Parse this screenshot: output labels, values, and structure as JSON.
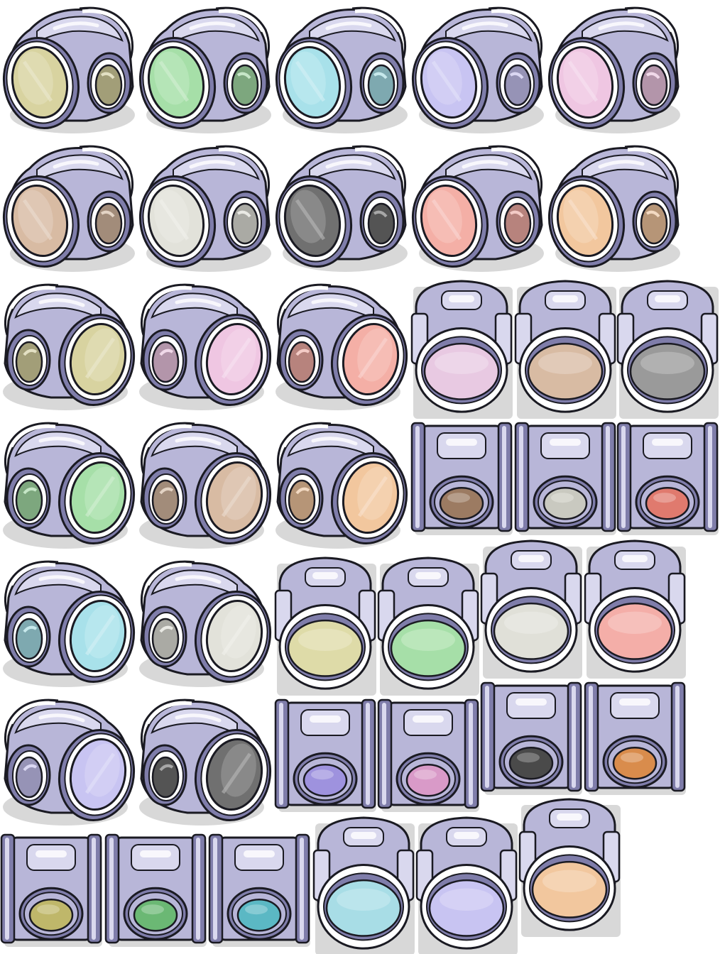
{
  "sprite_sheet": {
    "background": "#ffffff",
    "pipe_colors": {
      "body": "#b8b6d8",
      "body_light": "#d9d8ee",
      "body_dark": "#7f7daa",
      "outline": "#1a1a22",
      "rim": "#ffffff",
      "shadow": "#d8d8d8"
    },
    "sprites": [
      {
        "type": "corner-right-icon",
        "color": "#d8d3a0"
      },
      {
        "type": "corner-right-icon",
        "color": "#a6dfa8"
      },
      {
        "type": "corner-right-icon",
        "color": "#a8e1ea"
      },
      {
        "type": "corner-right-icon",
        "color": "#c8c4f2"
      },
      {
        "type": "corner-right-icon",
        "color": "#efc6e2"
      },
      {
        "type": "corner-right-icon",
        "color": "#d8bba3"
      },
      {
        "type": "corner-right-icon",
        "color": "#e2e2da"
      },
      {
        "type": "corner-right-icon",
        "color": "#707070"
      },
      {
        "type": "corner-right-icon",
        "color": "#f4afa6"
      },
      {
        "type": "corner-right-icon",
        "color": "#f2c79e"
      },
      {
        "type": "corner-left-icon",
        "color": "#d8d3a0"
      },
      {
        "type": "corner-left-icon",
        "color": "#efc6e2"
      },
      {
        "type": "corner-left-icon",
        "color": "#f4afa6"
      },
      {
        "type": "front-open-icon",
        "color": "#e8c9e2"
      },
      {
        "type": "front-open-icon",
        "color": "#d8bba3"
      },
      {
        "type": "front-open-icon",
        "color": "#9a9a9a"
      },
      {
        "type": "corner-left-icon",
        "color": "#a6dfa8"
      },
      {
        "type": "corner-left-icon",
        "color": "#d8bba3"
      },
      {
        "type": "corner-left-icon",
        "color": "#f2c79e"
      },
      {
        "type": "front-tee-icon",
        "color": "#9c7b62"
      },
      {
        "type": "front-tee-icon",
        "color": "#c9c9c0"
      },
      {
        "type": "front-tee-icon",
        "color": "#e07a6e"
      },
      {
        "type": "corner-left-icon",
        "color": "#a8e1ea"
      },
      {
        "type": "corner-left-icon",
        "color": "#e2e2da"
      },
      {
        "type": "front-open-icon",
        "color": "#dedba8"
      },
      {
        "type": "front-open-icon",
        "color": "#a6dfa8"
      },
      {
        "type": "front-open-icon",
        "color": "#e0e0d8"
      },
      {
        "type": "front-open-icon",
        "color": "#f4aea8"
      },
      {
        "type": "corner-left-icon",
        "color": "#c8c4f2"
      },
      {
        "type": "corner-left-icon",
        "color": "#707070"
      },
      {
        "type": "front-tee-icon",
        "color": "#9e92de"
      },
      {
        "type": "front-tee-icon",
        "color": "#d99ac8"
      },
      {
        "type": "front-tee-icon",
        "color": "#4a4a4a"
      },
      {
        "type": "front-tee-icon",
        "color": "#d98c4c"
      },
      {
        "type": "front-tee-icon",
        "color": "#bfb76a"
      },
      {
        "type": "front-tee-icon",
        "color": "#6bb874"
      },
      {
        "type": "front-tee-icon",
        "color": "#5bb8c4"
      },
      {
        "type": "front-open-icon",
        "color": "#a8dde6"
      },
      {
        "type": "front-open-icon",
        "color": "#c8c4f2"
      },
      {
        "type": "front-open-icon",
        "color": "#f2c79e"
      }
    ]
  }
}
